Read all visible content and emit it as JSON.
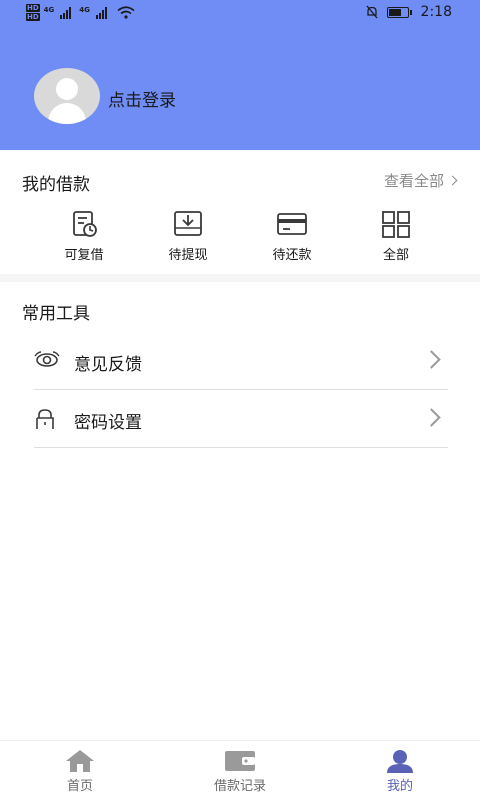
{
  "status_bar": {
    "time": "2:18",
    "hd1": "HD",
    "hd2": "HD",
    "net1": "4G",
    "net2": "4G"
  },
  "profile": {
    "login_label": "点击登录"
  },
  "loans": {
    "title": "我的借款",
    "view_all": "查看全部",
    "items": [
      {
        "label": "可复借",
        "icon": "document-refresh-icon"
      },
      {
        "label": "待提现",
        "icon": "download-tray-icon"
      },
      {
        "label": "待还款",
        "icon": "credit-card-icon"
      },
      {
        "label": "全部",
        "icon": "grid-icon"
      }
    ]
  },
  "tools": {
    "title": "常用工具",
    "items": [
      {
        "label": "意见反馈",
        "icon": "feedback-eye-icon"
      },
      {
        "label": "密码设置",
        "icon": "lock-icon"
      }
    ]
  },
  "bottom_nav": {
    "items": [
      {
        "label": "首页",
        "icon": "home-icon",
        "active": false
      },
      {
        "label": "借款记录",
        "icon": "wallet-icon",
        "active": false
      },
      {
        "label": "我的",
        "icon": "user-icon",
        "active": true
      }
    ]
  },
  "colors": {
    "header_bg": "#6f8df4",
    "active_nav": "#5a62b8",
    "inactive_nav": "#9a9a9a"
  }
}
